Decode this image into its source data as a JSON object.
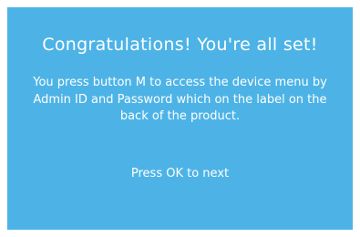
{
  "screen": {
    "background_color": "#4db3e6",
    "text_color": "#ffffff",
    "title": "Congratulations! You're all set!",
    "message": "You press button M to access the device menu by Admin ID and Password which on the label on the back of the product.",
    "prompt": "Press OK to next"
  }
}
